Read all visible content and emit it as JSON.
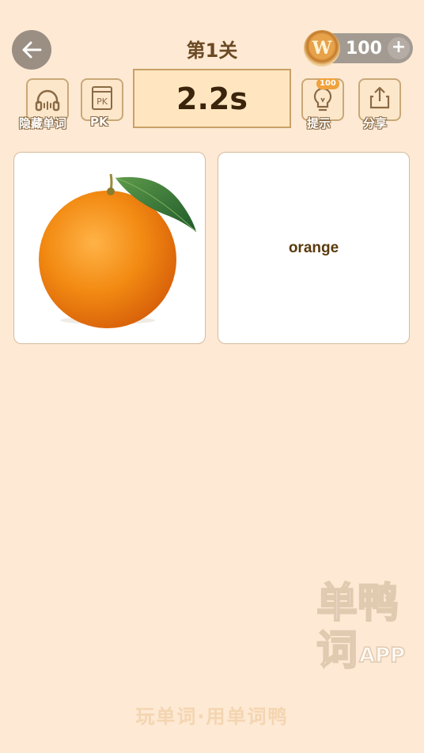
{
  "header": {
    "title": "第1关",
    "coins": "100",
    "coin_symbol": "W",
    "plus": "+"
  },
  "toolbar": {
    "hide_word_label": "隐藏单词",
    "pk_icon_text": "PK",
    "pk_label": "PK",
    "hint_label": "提示",
    "hint_cost": "100",
    "share_label": "分享"
  },
  "timer": {
    "value": "2.2s"
  },
  "cards": {
    "word": "orange"
  },
  "watermark": {
    "line1": "单鸭",
    "line2": "词",
    "app": "APP"
  },
  "footer": {
    "slogan": "玩单词·用单词鸭"
  },
  "colors": {
    "background": "#fde9d4",
    "accent": "#c9a066",
    "orange": "#f08a1c"
  },
  "icons": [
    "back-arrow-icon",
    "coin-icon",
    "plus-icon",
    "headphones-icon",
    "pk-icon",
    "lightbulb-icon",
    "share-icon"
  ]
}
